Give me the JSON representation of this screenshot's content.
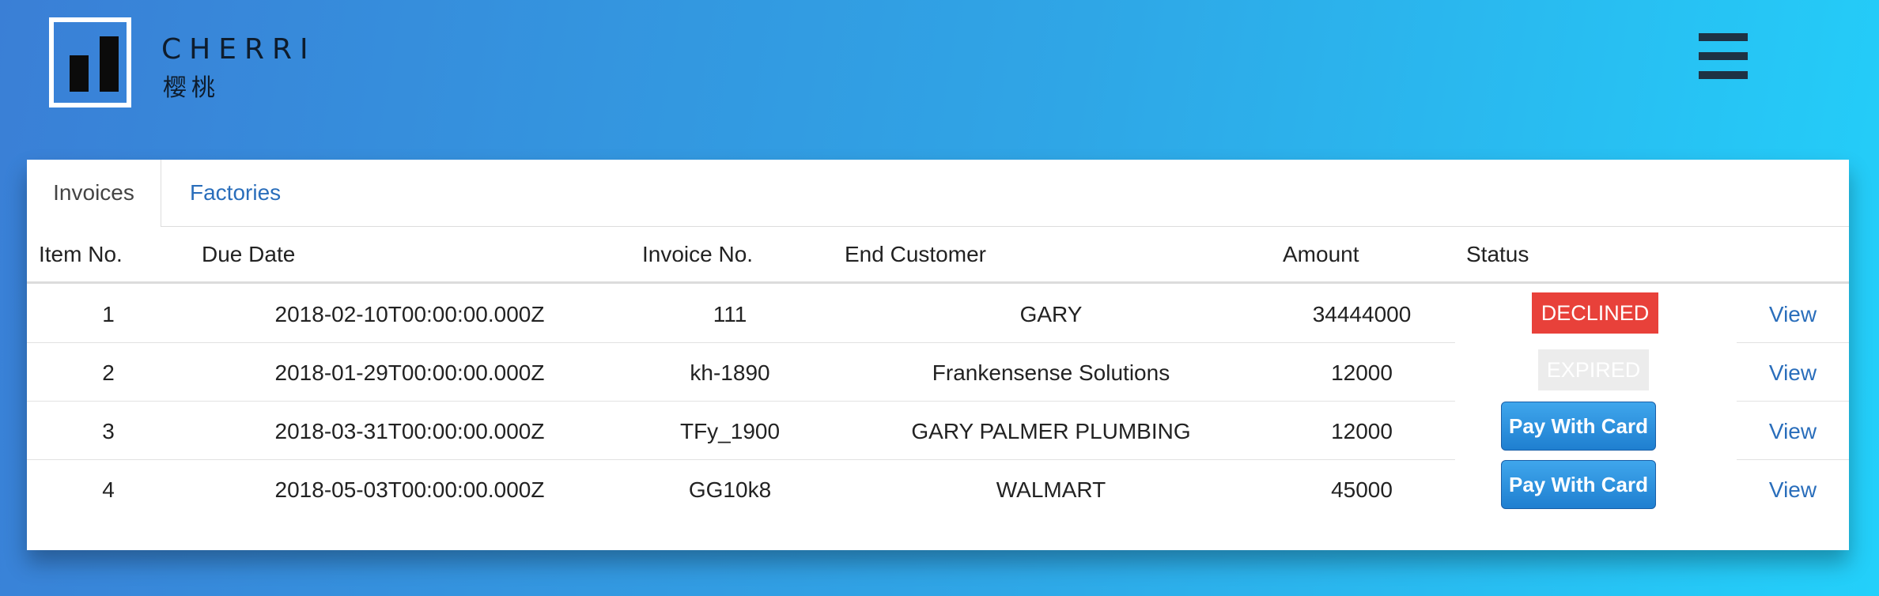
{
  "brand": {
    "name": "CHERRI",
    "subtitle": "樱桃"
  },
  "tabs": [
    {
      "label": "Invoices",
      "active": true
    },
    {
      "label": "Factories",
      "active": false
    }
  ],
  "table": {
    "headers": [
      "Item No.",
      "Due Date",
      "Invoice No.",
      "End Customer",
      "Amount",
      "Status"
    ],
    "rows": [
      {
        "item": "1",
        "due": "2018-02-10T00:00:00.000Z",
        "invoice": "111",
        "customer": "GARY",
        "amount": "34444000",
        "status": "DECLINED",
        "action": "View"
      },
      {
        "item": "2",
        "due": "2018-01-29T00:00:00.000Z",
        "invoice": "kh-1890",
        "customer": "Frankensense Solutions",
        "amount": "12000",
        "status": "EXPIRED",
        "action": "View"
      },
      {
        "item": "3",
        "due": "2018-03-31T00:00:00.000Z",
        "invoice": "TFy_1900",
        "customer": "GARY PALMER PLUMBING",
        "amount": "12000",
        "status": "Pay With Card",
        "action": "View"
      },
      {
        "item": "4",
        "due": "2018-05-03T00:00:00.000Z",
        "invoice": "GG10k8",
        "customer": "WALMART",
        "amount": "45000",
        "status": "Pay With Card",
        "action": "View"
      }
    ]
  },
  "colors": {
    "declined": "#e8413a",
    "expired": "#ececec",
    "link": "#2a6ebb",
    "pay_button": "#2b8fdd"
  }
}
